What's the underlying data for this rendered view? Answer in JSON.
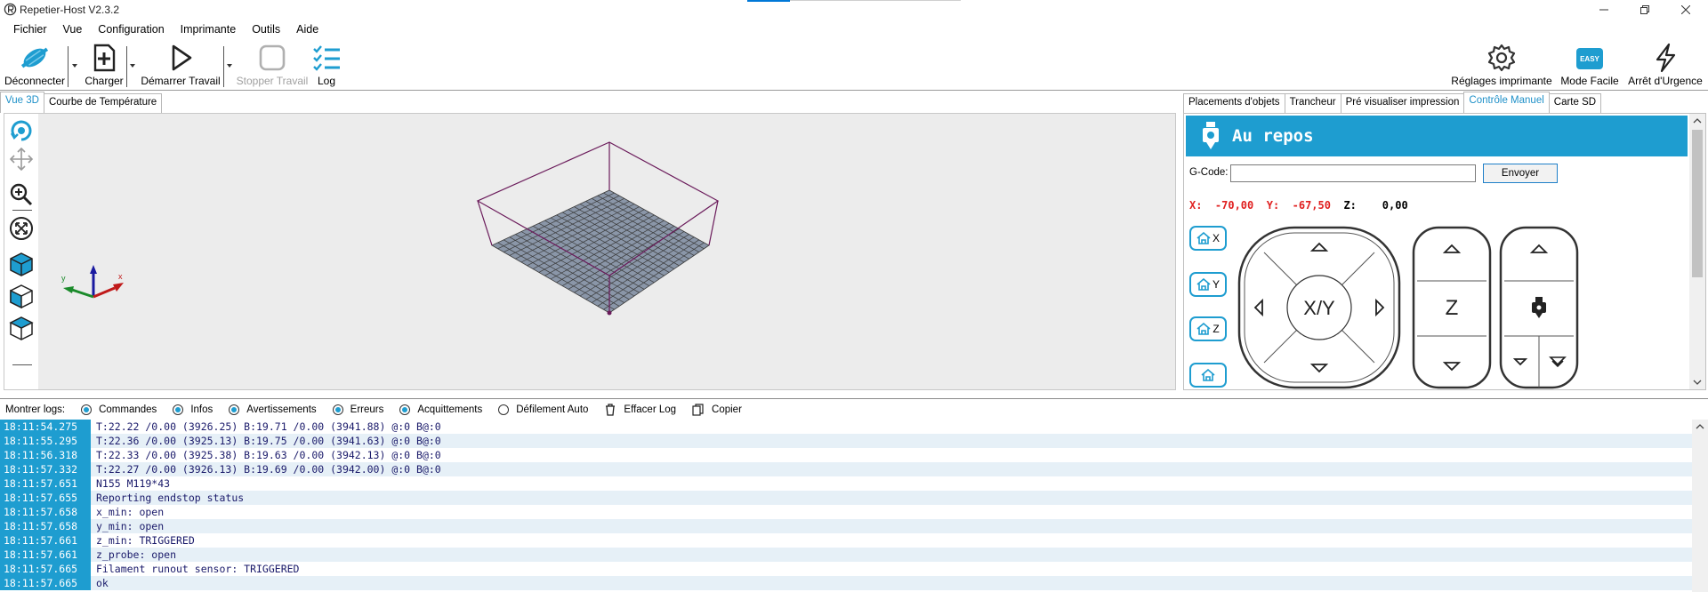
{
  "window": {
    "title": "Repetier-Host V2.3.2"
  },
  "menu": [
    "Fichier",
    "Vue",
    "Configuration",
    "Imprimante",
    "Outils",
    "Aide"
  ],
  "toolbar": {
    "disconnect": "Déconnecter",
    "load": "Charger",
    "start_job": "Démarrer Travail",
    "stop_job": "Stopper Travail",
    "log": "Log",
    "printer_settings": "Réglages imprimante",
    "easy_mode": "Mode Facile",
    "easy_badge": "EASY",
    "emergency_stop": "Arrêt d'Urgence"
  },
  "left_tabs": [
    "Vue 3D",
    "Courbe de Température"
  ],
  "right_tabs": [
    "Placements d'objets",
    "Trancheur",
    "Pré visualiser impression",
    "Contrôle Manuel",
    "Carte SD"
  ],
  "manual_control": {
    "status": "Au repos",
    "gcode_label": "G-Code:",
    "gcode_value": "",
    "send_button": "Envoyer",
    "x_label": "X:",
    "x_value": "-70,00",
    "y_label": "Y:",
    "y_value": "-67,50",
    "z_label": "Z:",
    "z_value": "0,00",
    "home_x": "X",
    "home_y": "Y",
    "home_z": "Z",
    "xy_label": "X/Y",
    "z_jog_label": "Z"
  },
  "log_filters": {
    "title": "Montrer logs:",
    "commands": "Commandes",
    "infos": "Infos",
    "warnings": "Avertissements",
    "errors": "Erreurs",
    "acks": "Acquittements",
    "autoscroll": "Défilement Auto",
    "clear": "Effacer Log",
    "copy": "Copier"
  },
  "log": [
    {
      "time": "18:11:54.275",
      "msg": "T:22.22 /0.00 (3926.25) B:19.71 /0.00 (3941.88) @:0 B@:0"
    },
    {
      "time": "18:11:55.295",
      "msg": "T:22.36 /0.00 (3925.13) B:19.75 /0.00 (3941.63) @:0 B@:0"
    },
    {
      "time": "18:11:56.318",
      "msg": "T:22.33 /0.00 (3925.38) B:19.63 /0.00 (3942.13) @:0 B@:0"
    },
    {
      "time": "18:11:57.332",
      "msg": "T:22.27 /0.00 (3926.13) B:19.69 /0.00 (3942.00) @:0 B@:0"
    },
    {
      "time": "18:11:57.651",
      "msg": "N155 M119*43"
    },
    {
      "time": "18:11:57.655",
      "msg": "Reporting endstop status"
    },
    {
      "time": "18:11:57.658",
      "msg": "x_min: open"
    },
    {
      "time": "18:11:57.658",
      "msg": "y_min: open"
    },
    {
      "time": "18:11:57.661",
      "msg": "z_min: TRIGGERED"
    },
    {
      "time": "18:11:57.661",
      "msg": "z_probe: open"
    },
    {
      "time": "18:11:57.665",
      "msg": "Filament runout sensor: TRIGGERED"
    },
    {
      "time": "18:11:57.665",
      "msg": "ok"
    }
  ],
  "colors": {
    "accent": "#1e9dd0",
    "coord_red": "#e02020",
    "bed": "#8a96a8",
    "box": "#6a1a5a"
  }
}
